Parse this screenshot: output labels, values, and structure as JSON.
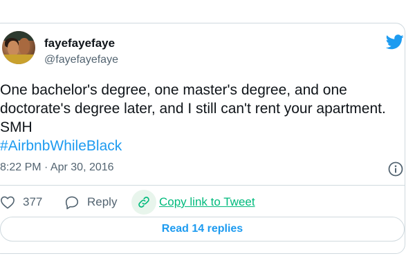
{
  "user": {
    "display_name": "fayefayefaye",
    "handle": "@fayefayefaye"
  },
  "tweet": {
    "text": "One bachelor's degree, one master's degree, and one doctorate's degree later, and I still can't rent your apartment. SMH",
    "hashtag": "#AirbnbWhileBlack",
    "timestamp": "8:22 PM · Apr 30, 2016"
  },
  "actions": {
    "like_count": "377",
    "reply_label": "Reply",
    "copy_link_label": "Copy link to Tweet"
  },
  "footer": {
    "read_replies_label": "Read 14 replies"
  },
  "icons": {
    "brand": "twitter-bird-icon",
    "info": "info-icon",
    "like": "heart-icon",
    "reply": "speech-bubble-icon",
    "copy": "link-icon"
  },
  "colors": {
    "accent": "#1d9bf0",
    "secondary_text": "#536471",
    "copy_link": "#00ba7c",
    "border": "#cfd9de"
  }
}
